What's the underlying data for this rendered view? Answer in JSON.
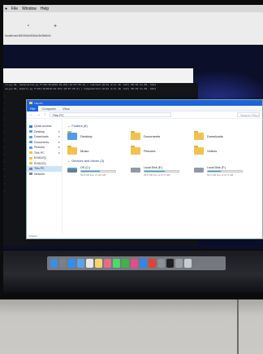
{
  "mac_menubar": {
    "items": [
      "File",
      "Window",
      "Help"
    ]
  },
  "background_browser": {
    "tab_dots": "•",
    "new_tab_icon": "plus-icon",
    "url": "localhost:5000/#/d0b4c3e5b0c5"
  },
  "terminal": {
    "lines": [
      "ro.py:44, Generalize.py Fr10x:8[2019-01-03]:{9:07:25.5] / reached:{9:01 4:11 18 -S27] 00:03:11.85, 3121",
      "se.py:44, Dublin.py Fr10x:8[2019-01-03]:{9:07:25.5] / ComputerSim:{9:01 4:11 18 -S27] 00:03:11.85, 4421"
    ],
    "side_lines": [
      ":",
      ":",
      ":",
      ":",
      ":",
      ":",
      ":",
      ":",
      ":",
      ":",
      ":",
      ":",
      ":",
      ":"
    ]
  },
  "explorer": {
    "title": "This PC",
    "ribbon_tabs": [
      "File",
      "Computer",
      "View"
    ],
    "address": "This PC",
    "search_placeholder": "Search This PC",
    "nav_items": [
      {
        "label": "Quick access",
        "icon": "star-icon",
        "pinned": false
      },
      {
        "label": "Desktop",
        "icon": "desktop-icon",
        "pinned": true
      },
      {
        "label": "Downloads",
        "icon": "download-icon",
        "pinned": true
      },
      {
        "label": "Documents",
        "icon": "documents-icon",
        "pinned": true
      },
      {
        "label": "Pictures",
        "icon": "pictures-icon",
        "pinned": true
      },
      {
        "label": "This PC",
        "icon": "folder-icon",
        "pinned": true
      },
      {
        "label": "EHAD2Q",
        "icon": "folder-icon",
        "pinned": false
      },
      {
        "label": "EHAD2Q",
        "icon": "folder-icon",
        "pinned": false
      },
      {
        "label": "This PC",
        "icon": "computer-icon",
        "pinned": false
      },
      {
        "label": "Network",
        "icon": "network-icon",
        "pinned": false
      }
    ],
    "folders_header": "Folders (6)",
    "folders": [
      {
        "label": "Desktop",
        "icon": "desktop-folder-icon"
      },
      {
        "label": "Documents",
        "icon": "documents-folder-icon"
      },
      {
        "label": "Downloads",
        "icon": "downloads-folder-icon"
      },
      {
        "label": "Music",
        "icon": "music-folder-icon"
      },
      {
        "label": "Pictures",
        "icon": "pictures-folder-icon"
      },
      {
        "label": "Videos",
        "icon": "videos-folder-icon"
      }
    ],
    "drives_header": "Devices and drives (3)",
    "drives": [
      {
        "name": "OS (C:)",
        "free": "52.9 GB free of 118 GB",
        "used_fraction": 0.55,
        "icon": "windows-drive-icon"
      },
      {
        "name": "Local Disk (E:)",
        "free": "39.5 GB free of 97.6 GB",
        "used_fraction": 0.6,
        "icon": "drive-icon"
      },
      {
        "name": "Local Disk (F:)",
        "free": "60.6 GB free of 97.6 GB",
        "used_fraction": 0.38,
        "icon": "drive-icon"
      }
    ],
    "status": "9 items"
  },
  "dock": {
    "icons": [
      {
        "name": "finder-icon",
        "color": "#3a8ee6"
      },
      {
        "name": "launchpad-icon",
        "color": "#7a7f88"
      },
      {
        "name": "safari-icon",
        "color": "#2f8ef5"
      },
      {
        "name": "mail-icon",
        "color": "#5aa2e6"
      },
      {
        "name": "calendar-icon",
        "color": "#e8e8e8"
      },
      {
        "name": "notes-icon",
        "color": "#f3d66a"
      },
      {
        "name": "photos-icon",
        "color": "#e86a8a"
      },
      {
        "name": "messages-icon",
        "color": "#4cd964"
      },
      {
        "name": "facetime-icon",
        "color": "#3cb44a"
      },
      {
        "name": "itunes-icon",
        "color": "#e84a8a"
      },
      {
        "name": "app-store-icon",
        "color": "#2f86f0"
      },
      {
        "name": "chrome-icon",
        "color": "#e44134"
      },
      {
        "name": "system-preferences-icon",
        "color": "#8a8f98"
      },
      {
        "name": "terminal-icon",
        "color": "#1f1f1f"
      },
      {
        "name": "vmware-icon",
        "color": "#9aa0a8"
      },
      {
        "name": "trash-icon",
        "color": "#c8ccd2"
      }
    ]
  }
}
